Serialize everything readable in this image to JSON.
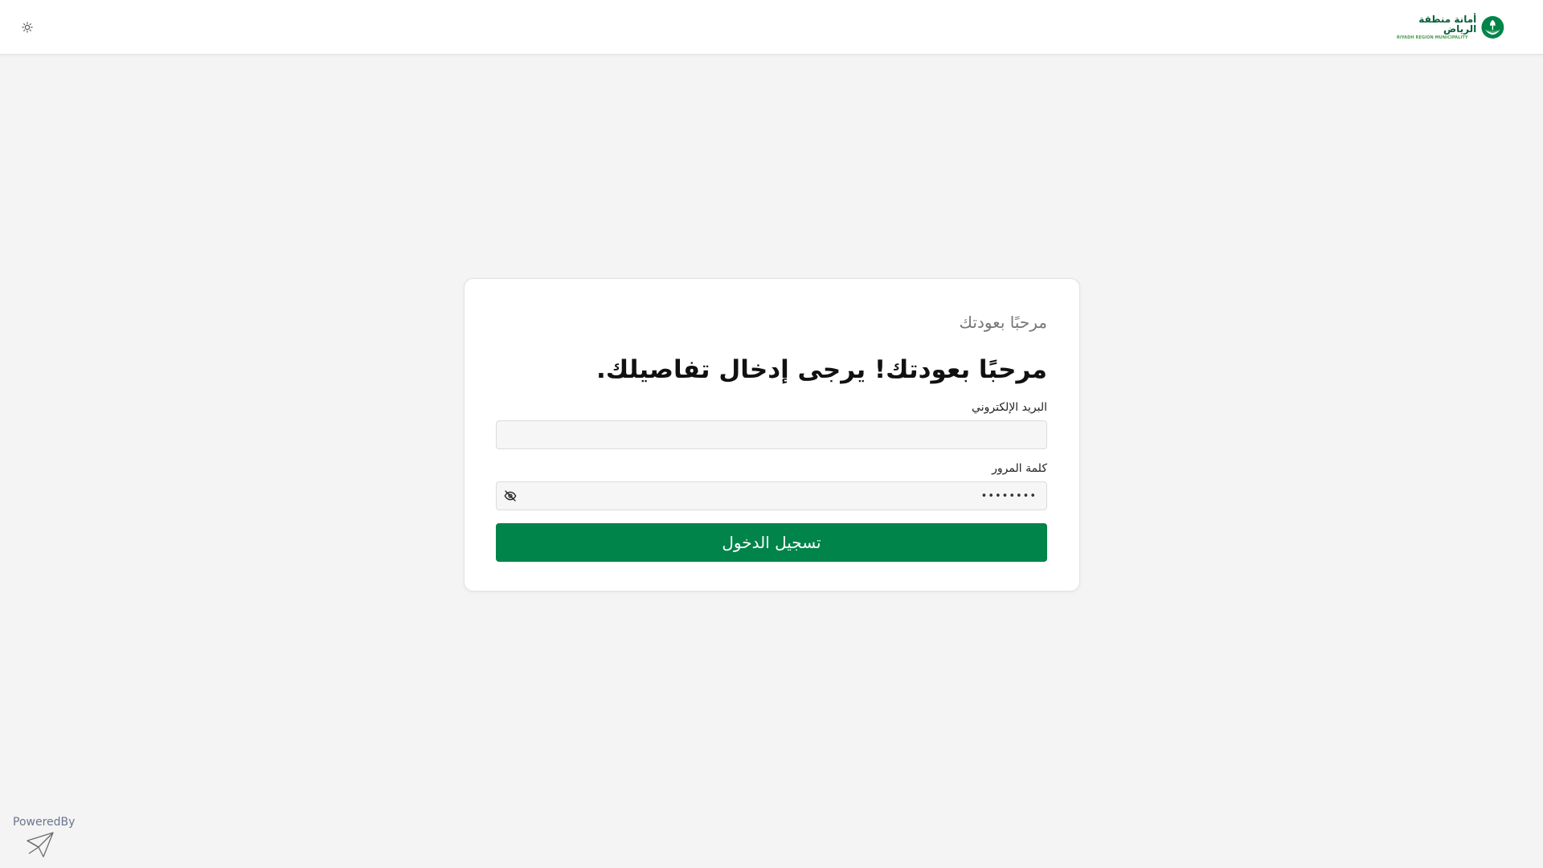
{
  "colors": {
    "brand": "#00844a",
    "brand_dark": "#0b5f3c",
    "brand_light": "#4a9a4e",
    "page_bg": "#f4f4f4"
  },
  "header": {
    "theme_icon": "sun-icon",
    "logo": {
      "emblem_icon": "riyadh-emblem-icon",
      "name_ar": "أمانة منطقة الرياض",
      "name_en": "RIYADH REGION MUNICIPALITY"
    }
  },
  "login": {
    "subtitle": "مرحبًا بعودتك",
    "heading": "مرحبًا بعودتك! يرجى إدخال تفاصيلك.",
    "email": {
      "label": "البريد الإلكتروني",
      "value": "",
      "placeholder": ""
    },
    "password": {
      "label": "كلمة المرور",
      "value": "password",
      "toggle_icon": "eye-off-icon"
    },
    "submit_label": "تسجيل الدخول"
  },
  "footer": {
    "powered_by": "PoweredBy",
    "powered_icon": "paper-plane-icon"
  }
}
